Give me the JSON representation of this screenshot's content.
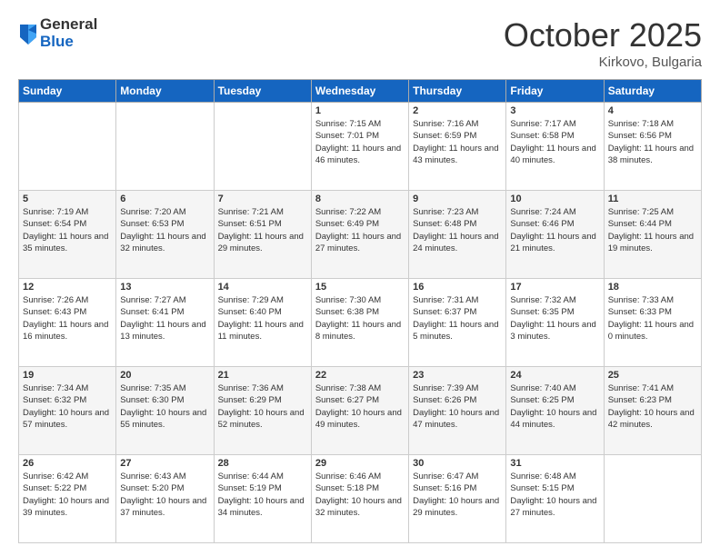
{
  "logo": {
    "general": "General",
    "blue": "Blue"
  },
  "title": "October 2025",
  "location": "Kirkovo, Bulgaria",
  "days_header": [
    "Sunday",
    "Monday",
    "Tuesday",
    "Wednesday",
    "Thursday",
    "Friday",
    "Saturday"
  ],
  "weeks": [
    [
      {
        "num": "",
        "sunrise": "",
        "sunset": "",
        "daylight": ""
      },
      {
        "num": "",
        "sunrise": "",
        "sunset": "",
        "daylight": ""
      },
      {
        "num": "",
        "sunrise": "",
        "sunset": "",
        "daylight": ""
      },
      {
        "num": "1",
        "sunrise": "Sunrise: 7:15 AM",
        "sunset": "Sunset: 7:01 PM",
        "daylight": "Daylight: 11 hours and 46 minutes."
      },
      {
        "num": "2",
        "sunrise": "Sunrise: 7:16 AM",
        "sunset": "Sunset: 6:59 PM",
        "daylight": "Daylight: 11 hours and 43 minutes."
      },
      {
        "num": "3",
        "sunrise": "Sunrise: 7:17 AM",
        "sunset": "Sunset: 6:58 PM",
        "daylight": "Daylight: 11 hours and 40 minutes."
      },
      {
        "num": "4",
        "sunrise": "Sunrise: 7:18 AM",
        "sunset": "Sunset: 6:56 PM",
        "daylight": "Daylight: 11 hours and 38 minutes."
      }
    ],
    [
      {
        "num": "5",
        "sunrise": "Sunrise: 7:19 AM",
        "sunset": "Sunset: 6:54 PM",
        "daylight": "Daylight: 11 hours and 35 minutes."
      },
      {
        "num": "6",
        "sunrise": "Sunrise: 7:20 AM",
        "sunset": "Sunset: 6:53 PM",
        "daylight": "Daylight: 11 hours and 32 minutes."
      },
      {
        "num": "7",
        "sunrise": "Sunrise: 7:21 AM",
        "sunset": "Sunset: 6:51 PM",
        "daylight": "Daylight: 11 hours and 29 minutes."
      },
      {
        "num": "8",
        "sunrise": "Sunrise: 7:22 AM",
        "sunset": "Sunset: 6:49 PM",
        "daylight": "Daylight: 11 hours and 27 minutes."
      },
      {
        "num": "9",
        "sunrise": "Sunrise: 7:23 AM",
        "sunset": "Sunset: 6:48 PM",
        "daylight": "Daylight: 11 hours and 24 minutes."
      },
      {
        "num": "10",
        "sunrise": "Sunrise: 7:24 AM",
        "sunset": "Sunset: 6:46 PM",
        "daylight": "Daylight: 11 hours and 21 minutes."
      },
      {
        "num": "11",
        "sunrise": "Sunrise: 7:25 AM",
        "sunset": "Sunset: 6:44 PM",
        "daylight": "Daylight: 11 hours and 19 minutes."
      }
    ],
    [
      {
        "num": "12",
        "sunrise": "Sunrise: 7:26 AM",
        "sunset": "Sunset: 6:43 PM",
        "daylight": "Daylight: 11 hours and 16 minutes."
      },
      {
        "num": "13",
        "sunrise": "Sunrise: 7:27 AM",
        "sunset": "Sunset: 6:41 PM",
        "daylight": "Daylight: 11 hours and 13 minutes."
      },
      {
        "num": "14",
        "sunrise": "Sunrise: 7:29 AM",
        "sunset": "Sunset: 6:40 PM",
        "daylight": "Daylight: 11 hours and 11 minutes."
      },
      {
        "num": "15",
        "sunrise": "Sunrise: 7:30 AM",
        "sunset": "Sunset: 6:38 PM",
        "daylight": "Daylight: 11 hours and 8 minutes."
      },
      {
        "num": "16",
        "sunrise": "Sunrise: 7:31 AM",
        "sunset": "Sunset: 6:37 PM",
        "daylight": "Daylight: 11 hours and 5 minutes."
      },
      {
        "num": "17",
        "sunrise": "Sunrise: 7:32 AM",
        "sunset": "Sunset: 6:35 PM",
        "daylight": "Daylight: 11 hours and 3 minutes."
      },
      {
        "num": "18",
        "sunrise": "Sunrise: 7:33 AM",
        "sunset": "Sunset: 6:33 PM",
        "daylight": "Daylight: 11 hours and 0 minutes."
      }
    ],
    [
      {
        "num": "19",
        "sunrise": "Sunrise: 7:34 AM",
        "sunset": "Sunset: 6:32 PM",
        "daylight": "Daylight: 10 hours and 57 minutes."
      },
      {
        "num": "20",
        "sunrise": "Sunrise: 7:35 AM",
        "sunset": "Sunset: 6:30 PM",
        "daylight": "Daylight: 10 hours and 55 minutes."
      },
      {
        "num": "21",
        "sunrise": "Sunrise: 7:36 AM",
        "sunset": "Sunset: 6:29 PM",
        "daylight": "Daylight: 10 hours and 52 minutes."
      },
      {
        "num": "22",
        "sunrise": "Sunrise: 7:38 AM",
        "sunset": "Sunset: 6:27 PM",
        "daylight": "Daylight: 10 hours and 49 minutes."
      },
      {
        "num": "23",
        "sunrise": "Sunrise: 7:39 AM",
        "sunset": "Sunset: 6:26 PM",
        "daylight": "Daylight: 10 hours and 47 minutes."
      },
      {
        "num": "24",
        "sunrise": "Sunrise: 7:40 AM",
        "sunset": "Sunset: 6:25 PM",
        "daylight": "Daylight: 10 hours and 44 minutes."
      },
      {
        "num": "25",
        "sunrise": "Sunrise: 7:41 AM",
        "sunset": "Sunset: 6:23 PM",
        "daylight": "Daylight: 10 hours and 42 minutes."
      }
    ],
    [
      {
        "num": "26",
        "sunrise": "Sunrise: 6:42 AM",
        "sunset": "Sunset: 5:22 PM",
        "daylight": "Daylight: 10 hours and 39 minutes."
      },
      {
        "num": "27",
        "sunrise": "Sunrise: 6:43 AM",
        "sunset": "Sunset: 5:20 PM",
        "daylight": "Daylight: 10 hours and 37 minutes."
      },
      {
        "num": "28",
        "sunrise": "Sunrise: 6:44 AM",
        "sunset": "Sunset: 5:19 PM",
        "daylight": "Daylight: 10 hours and 34 minutes."
      },
      {
        "num": "29",
        "sunrise": "Sunrise: 6:46 AM",
        "sunset": "Sunset: 5:18 PM",
        "daylight": "Daylight: 10 hours and 32 minutes."
      },
      {
        "num": "30",
        "sunrise": "Sunrise: 6:47 AM",
        "sunset": "Sunset: 5:16 PM",
        "daylight": "Daylight: 10 hours and 29 minutes."
      },
      {
        "num": "31",
        "sunrise": "Sunrise: 6:48 AM",
        "sunset": "Sunset: 5:15 PM",
        "daylight": "Daylight: 10 hours and 27 minutes."
      },
      {
        "num": "",
        "sunrise": "",
        "sunset": "",
        "daylight": ""
      }
    ]
  ]
}
